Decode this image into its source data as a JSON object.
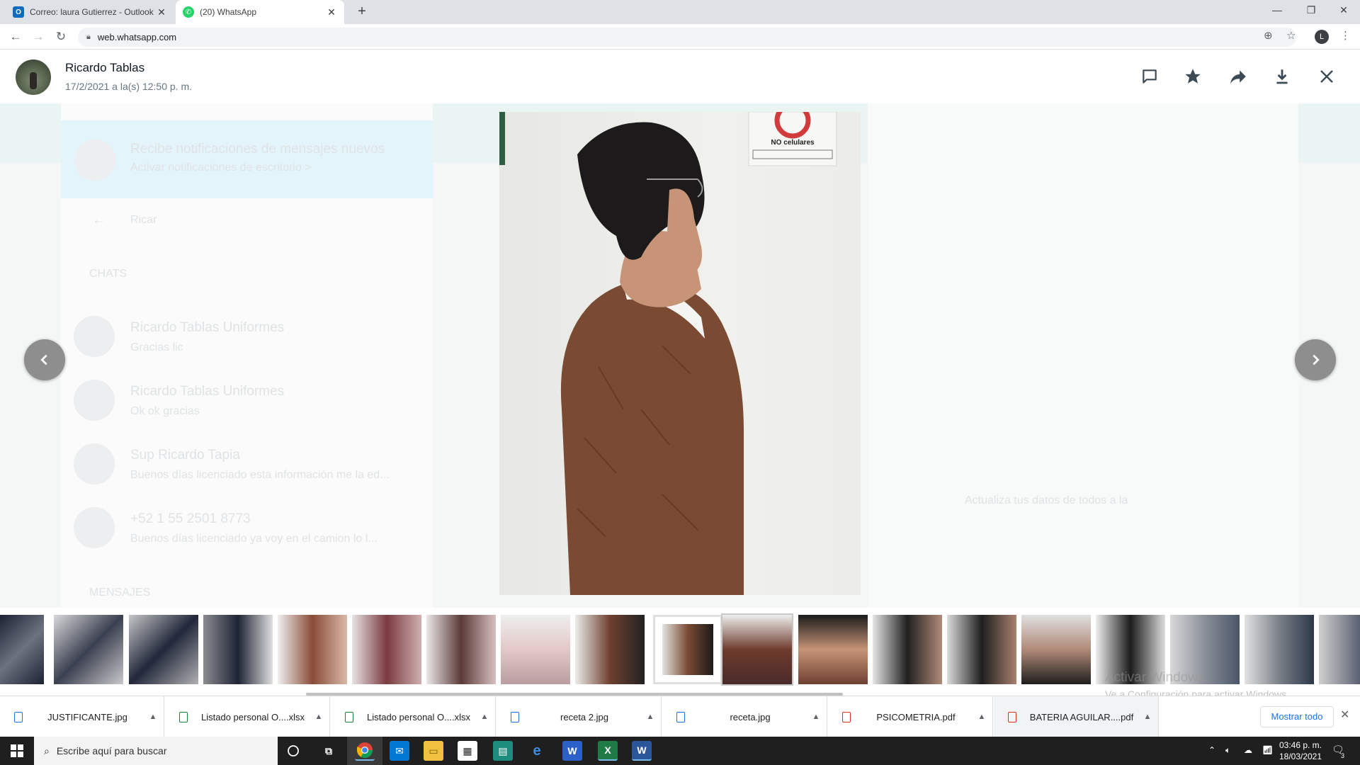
{
  "browser": {
    "tabs": [
      {
        "title": "Correo: laura Gutierrez - Outlook"
      },
      {
        "title": "(20) WhatsApp"
      }
    ],
    "url": "web.whatsapp.com",
    "profile_initial": "L"
  },
  "viewer": {
    "sender_name": "Ricardo Tablas",
    "sent_time": "17/2/2021 a la(s) 12:50 p. m.",
    "photo_sign_text": "NO celulares",
    "watermark_line1": "Activar Windows",
    "watermark_line2": "Ve a Configuración para activar Windows."
  },
  "background_ui": {
    "notice_title": "Recibe notificaciones de mensajes nuevos",
    "notice_link": "Activar notificaciones de escritorio >",
    "search_value": "Ricar",
    "section_chats": "CHATS",
    "section_messages": "MENSAJES",
    "chats": [
      {
        "name": "Ricardo Tablas Uniformes",
        "preview": "Gracias lic"
      },
      {
        "name": "Ricardo Tablas Uniformes",
        "preview": "Ok ok gracias"
      },
      {
        "name": "Sup Ricardo Tapia",
        "preview": "Buenos días licenciado esta información me la ed..."
      },
      {
        "name": "+52 1 55 2501 8773",
        "preview": "Buenos días licenciado ya voy en el camion lo l..."
      }
    ],
    "right_hint": "Actualiza tus datos de todos a la"
  },
  "downloads": {
    "items": [
      {
        "name": "JUSTIFICANTE.jpg",
        "type": "jpg"
      },
      {
        "name": "Listado personal O....xlsx",
        "type": "xlsx"
      },
      {
        "name": "Listado personal O....xlsx",
        "type": "xlsx"
      },
      {
        "name": "receta 2.jpg",
        "type": "jpg"
      },
      {
        "name": "receta.jpg",
        "type": "jpg"
      },
      {
        "name": "PSICOMETRIA.pdf",
        "type": "pdf"
      },
      {
        "name": "BATERIA AGUILAR....pdf",
        "type": "pdf"
      }
    ],
    "show_all_label": "Mostrar todo"
  },
  "taskbar": {
    "search_placeholder": "Escribe aquí para buscar",
    "time": "03:46 p. m.",
    "date": "18/03/2021",
    "notification_count": "3"
  },
  "colors": {
    "whatsapp_green": "#25d366",
    "link_blue": "#1a73e8",
    "nav_arrow_gray": "#8e8e8e"
  }
}
